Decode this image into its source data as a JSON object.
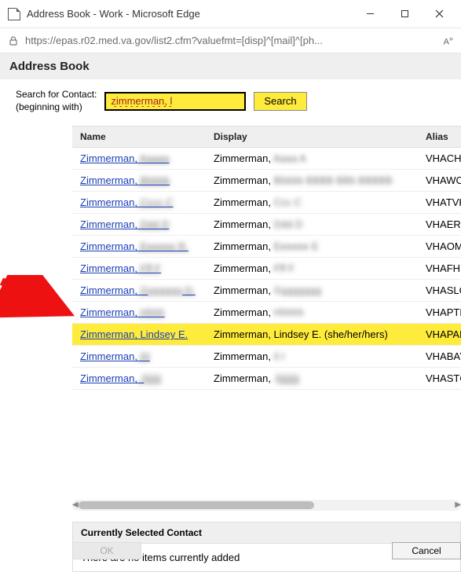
{
  "window": {
    "title": "Address Book - Work - Microsoft Edge",
    "url": "https://epas.r02.med.va.gov/list2.cfm?valuefmt=[disp]^[mail]^[ph..."
  },
  "page": {
    "heading": "Address Book",
    "search_label_l1": "Search for Contact:",
    "search_label_l2": "(beginning with)",
    "search_value": "zimmerman, l",
    "search_button": "Search"
  },
  "table": {
    "columns": {
      "name": "Name",
      "display": "Display",
      "alias": "Alias"
    },
    "rows": [
      {
        "name_vis": "Zimmerman,",
        "name_blur": "Aaaaa",
        "disp_vis": "Zimmerman,",
        "disp_blur": "Aaaa A",
        "alias": "VHACHS",
        "highlight": false
      },
      {
        "name_vis": "Zimmerman,",
        "name_blur": "Bbbbb",
        "disp_vis": "Zimmerman,",
        "disp_blur": "Bbbbb BBBB BBb BBBBB",
        "alias": "VHAWCO",
        "highlight": false
      },
      {
        "name_vis": "Zimmerman,",
        "name_blur": "Cccc C",
        "disp_vis": "Zimmerman,",
        "disp_blur": "Ccc C",
        "alias": "VHATVH",
        "highlight": false
      },
      {
        "name_vis": "Zimmerman,",
        "name_blur": "Ddd D",
        "disp_vis": "Zimmerman,",
        "disp_blur": "Ddd D",
        "alias": "VHAERI",
        "highlight": false
      },
      {
        "name_vis": "Zimmerman,",
        "name_blur": "Eeeeee R.",
        "disp_vis": "Zimmerman,",
        "disp_blur": "Eeeeee E",
        "alias": "VHAOMA",
        "highlight": false
      },
      {
        "name_vis": "Zimmerman,",
        "name_blur": "Fff F",
        "disp_vis": "Zimmerman,",
        "disp_blur": "Fff F",
        "alias": "VHAFHM",
        "highlight": false
      },
      {
        "name_vis": "Zimmerman,",
        "name_blur": "Ggggggg D.",
        "disp_vis": "Zimmerman,",
        "disp_blur": "Gggggggg",
        "alias": "VHASLC",
        "highlight": false
      },
      {
        "name_vis": "Zimmerman,",
        "name_blur": "Hhhh",
        "disp_vis": "Zimmerman,",
        "disp_blur": "Hhhhh",
        "alias": "VHAPTH",
        "highlight": false
      },
      {
        "name_vis": "Zimmerman, Lindsey E.",
        "name_blur": "",
        "disp_vis": "Zimmerman, Lindsey E. (she/her/hers)",
        "disp_blur": "",
        "alias": "VHAPALZ",
        "highlight": true
      },
      {
        "name_vis": "Zimmerman,",
        "name_blur": "Iiii",
        "disp_vis": "Zimmerman,",
        "disp_blur": "Ii I",
        "alias": "VHABAY",
        "highlight": false
      },
      {
        "name_vis": "Zimmerman,",
        "name_blur": "Jjjjjjjj",
        "disp_vis": "Zimmerman,",
        "disp_blur": "Jjjjjjjjjj",
        "alias": "VHASTC",
        "highlight": false
      }
    ]
  },
  "selected": {
    "heading": "Currently Selected Contact",
    "empty_text": "There are no items currently added"
  },
  "buttons": {
    "ok": "OK",
    "cancel": "Cancel"
  }
}
